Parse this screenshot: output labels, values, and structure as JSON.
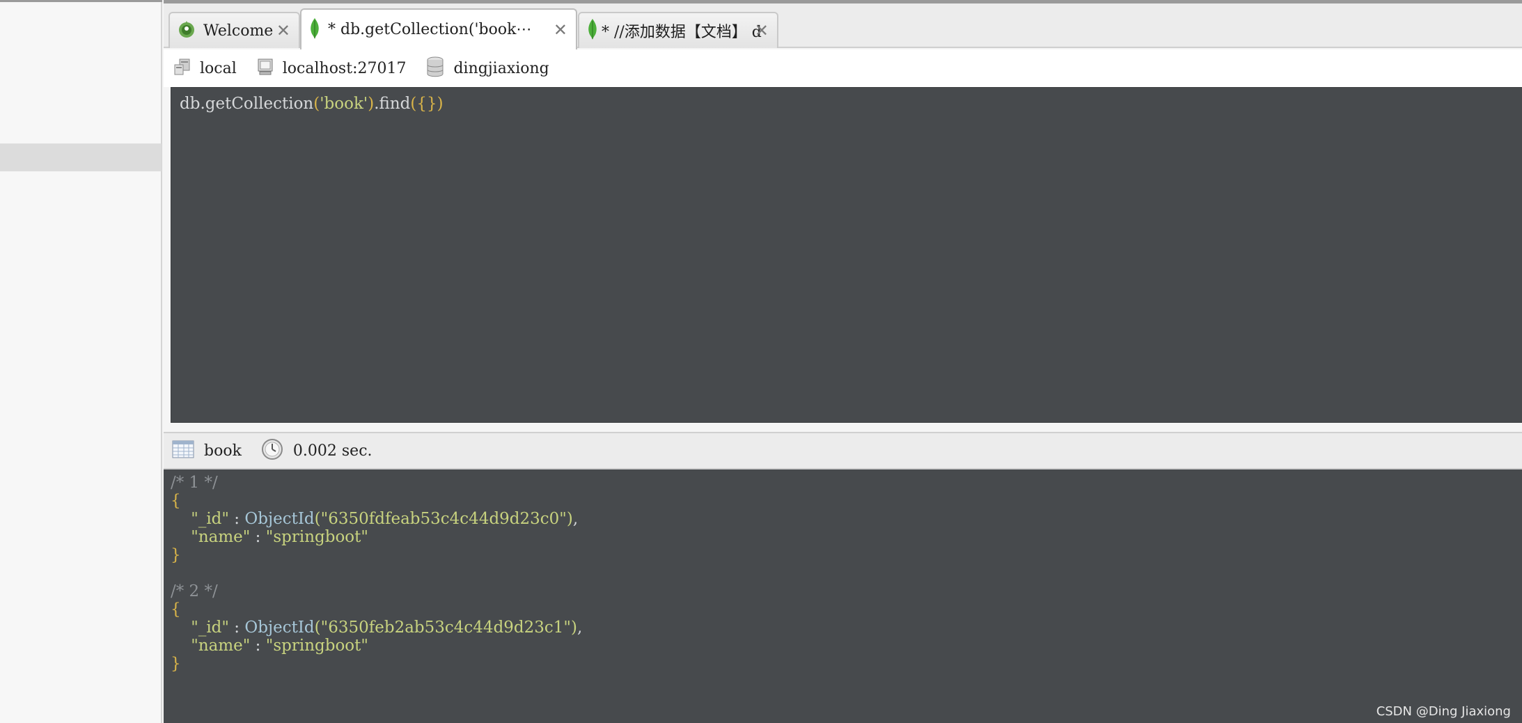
{
  "tabs": [
    {
      "label": "Welcome",
      "icon": "robomongo-logo-icon",
      "active": false
    },
    {
      "label": "* db.getCollection('book⋯",
      "icon": "mongo-leaf-icon",
      "active": true
    },
    {
      "label": "* //添加数据【文档】  db.⋯",
      "icon": "mongo-leaf-icon",
      "active": false
    }
  ],
  "connection": {
    "server": "local",
    "host": "localhost:27017",
    "database": "dingjiaxiong"
  },
  "editor": {
    "query_prefix": "db.getCollection",
    "query_open": "(",
    "query_arg": "'book'",
    "query_close": ")",
    "query_method": ".find",
    "query_args": "({})"
  },
  "result_header": {
    "collection": "book",
    "time": "0.002 sec."
  },
  "documents": [
    {
      "comment": "/* 1 */",
      "open": "{",
      "id_key": "\"_id\"",
      "sep": " : ",
      "id_func": "ObjectId",
      "id_value": "(\"6350fdfeab53c4c44d9d23c0\")",
      "comma": ",",
      "name_key": "\"name\"",
      "name_value": "\"springboot\"",
      "close": "}"
    },
    {
      "comment": "/* 2 */",
      "open": "{",
      "id_key": "\"_id\"",
      "sep": " : ",
      "id_func": "ObjectId",
      "id_value": "(\"6350feb2ab53c4c44d9d23c1\")",
      "comma": ",",
      "name_key": "\"name\"",
      "name_value": "\"springboot\"",
      "close": "}"
    }
  ],
  "watermark": "CSDN @Ding Jiaxiong",
  "colors": {
    "editor_bg": "#474a4d",
    "string": "#c8d37f",
    "brace": "#d9b449",
    "comment": "#8e9296"
  }
}
